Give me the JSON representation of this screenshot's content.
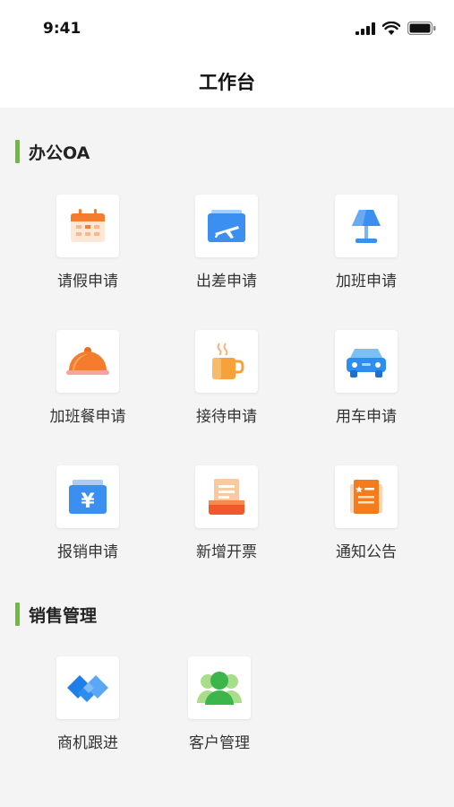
{
  "status": {
    "time": "9:41"
  },
  "nav": {
    "title": "工作台"
  },
  "sections": [
    {
      "title": "办公OA",
      "items": [
        {
          "label": "请假申请",
          "icon": "calendar-icon"
        },
        {
          "label": "出差申请",
          "icon": "airplane-ticket-icon"
        },
        {
          "label": "加班申请",
          "icon": "desk-lamp-icon"
        },
        {
          "label": "加班餐申请",
          "icon": "food-cloche-icon"
        },
        {
          "label": "接待申请",
          "icon": "coffee-cup-icon"
        },
        {
          "label": "用车申请",
          "icon": "car-icon"
        },
        {
          "label": "报销申请",
          "icon": "yuan-wallet-icon"
        },
        {
          "label": "新增开票",
          "icon": "invoice-printer-icon"
        },
        {
          "label": "通知公告",
          "icon": "notice-board-icon"
        }
      ]
    },
    {
      "title": "销售管理",
      "items": [
        {
          "label": "商机跟进",
          "icon": "handshake-icon"
        },
        {
          "label": "客户管理",
          "icon": "customers-icon"
        }
      ]
    }
  ],
  "colors": {
    "accent": "#6dbb3a",
    "background": "#f4f4f4"
  }
}
